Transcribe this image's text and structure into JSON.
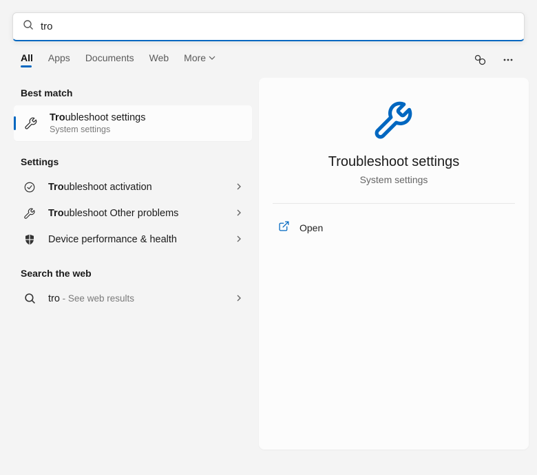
{
  "search": {
    "query": "tro"
  },
  "filters": {
    "all": "All",
    "apps": "Apps",
    "documents": "Documents",
    "web": "Web",
    "more": "More"
  },
  "sections": {
    "best_match": "Best match",
    "settings": "Settings",
    "search_web": "Search the web"
  },
  "best_match_item": {
    "prefix": "Tro",
    "rest": "ubleshoot settings",
    "subtitle": "System settings"
  },
  "settings_items": [
    {
      "prefix": "Tro",
      "rest": "ubleshoot activation",
      "icon": "check-circle"
    },
    {
      "prefix": "Tro",
      "rest": "ubleshoot Other problems",
      "icon": "wrench"
    },
    {
      "prefix": "",
      "rest": "Device performance & health",
      "icon": "shield"
    }
  ],
  "web_item": {
    "query": "tro",
    "suffix": " - See web results"
  },
  "preview": {
    "title": "Troubleshoot settings",
    "subtitle": "System settings",
    "actions": {
      "open": "Open"
    }
  }
}
